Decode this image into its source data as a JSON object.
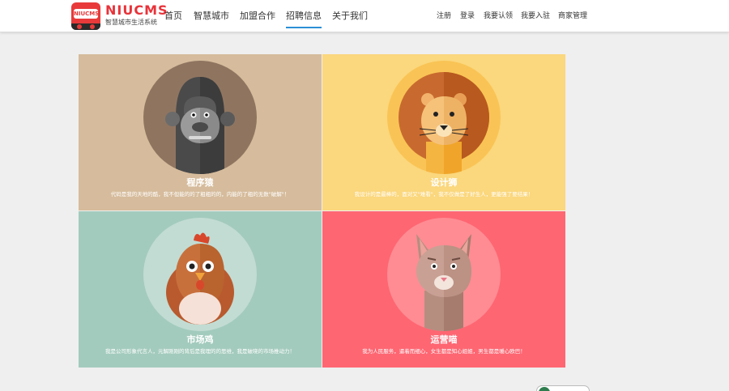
{
  "header": {
    "brand_name": "NIUCMS",
    "brand_sub": "智慧城市生活系统",
    "logo_text": "NIUCMS",
    "nav": [
      {
        "label": "首页"
      },
      {
        "label": "智慧城市"
      },
      {
        "label": "加盟合作"
      },
      {
        "label": "招聘信息",
        "active": true
      },
      {
        "label": "关于我们"
      }
    ],
    "right_links": [
      {
        "label": "注册"
      },
      {
        "label": "登录"
      },
      {
        "label": "我要认领"
      },
      {
        "label": "我要入驻"
      },
      {
        "label": "商家管理"
      }
    ]
  },
  "cards": [
    {
      "title": "程序猿",
      "desc": "代码是我的天地的酷，我不但能的的了粗粗的的，内能的了粗的无数\"破解\"！",
      "bg": "#d6bc9c",
      "circle": "#8f7560",
      "icon": "gorilla-icon"
    },
    {
      "title": "设计狮",
      "desc": "我设计的是最棒的，面对又\"难看\"，我不仅做是了好生人，更能强了要结果！",
      "bg": "#fbd77d",
      "circle": "#f9c455",
      "icon": "lion-icon"
    },
    {
      "title": "市场鸡",
      "desc": "我是公司形象代言人，元解刚刚的背后是我理的的思维，我是破晓的市场推动力！",
      "bg": "#a3cbbd",
      "circle": "#c2dcd3",
      "icon": "rooster-icon"
    },
    {
      "title": "运营喵",
      "desc": "我为人民服务，逼着而细心，女生都是知心姐姐，男生都是暖心欧巴！",
      "bg": "#fe6672",
      "circle": "#ff8c93",
      "icon": "cat-icon"
    }
  ]
}
